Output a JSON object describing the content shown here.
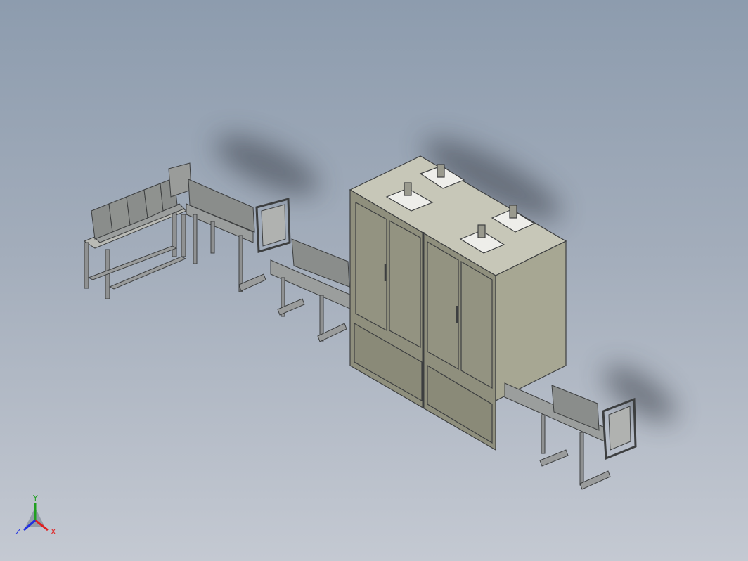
{
  "triad": {
    "x_label": "X",
    "y_label": "Y",
    "z_label": "Z",
    "x_color": "#e02020",
    "y_color": "#20a020",
    "z_color": "#2030e0"
  },
  "colors": {
    "cabinet_side": "#a7a793",
    "cabinet_front": "#8f8f7d",
    "cabinet_top": "#c7c7b8",
    "frame": "#7b7d7e",
    "conveyor": "#9b9e9d",
    "box": "#8a8d8b",
    "shadow": "#3a3f48"
  }
}
